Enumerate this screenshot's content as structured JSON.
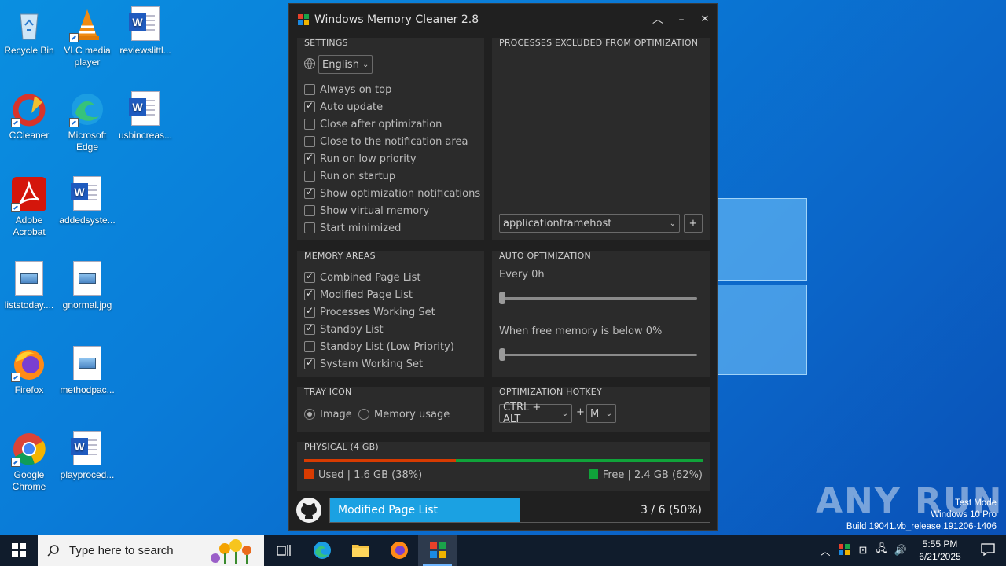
{
  "desktop": {
    "icons": [
      {
        "label": "Recycle Bin"
      },
      {
        "label": "VLC media player"
      },
      {
        "label": "reviewslittl..."
      },
      {
        "label": "CCleaner"
      },
      {
        "label": "Microsoft Edge"
      },
      {
        "label": "usbincreas..."
      },
      {
        "label": "Adobe Acrobat"
      },
      {
        "label": "addedsyste..."
      },
      {
        "label": "liststoday...."
      },
      {
        "label": "gnormal.jpg"
      },
      {
        "label": "Firefox"
      },
      {
        "label": "methodpac..."
      },
      {
        "label": "Google Chrome"
      },
      {
        "label": "playproced..."
      }
    ],
    "watermark": {
      "brand": "ANY RUN",
      "line1": "Test Mode",
      "line2": "Windows 10 Pro",
      "line3": "Build 19041.vb_release.191206-1406"
    }
  },
  "app": {
    "title": "Windows Memory Cleaner 2.8",
    "settings": {
      "title": "SETTINGS",
      "language": "English",
      "options": [
        {
          "label": "Always on top",
          "checked": false
        },
        {
          "label": "Auto update",
          "checked": true
        },
        {
          "label": "Close after optimization",
          "checked": false
        },
        {
          "label": "Close to the notification area",
          "checked": false
        },
        {
          "label": "Run on low priority",
          "checked": true
        },
        {
          "label": "Run on startup",
          "checked": false
        },
        {
          "label": "Show optimization notifications",
          "checked": true
        },
        {
          "label": "Show virtual memory",
          "checked": false
        },
        {
          "label": "Start minimized",
          "checked": false
        }
      ]
    },
    "excluded": {
      "title": "PROCESSES EXCLUDED FROM OPTIMIZATION",
      "selected_process": "applicationframehost",
      "add_label": "+"
    },
    "memory_areas": {
      "title": "MEMORY AREAS",
      "items": [
        {
          "label": "Combined Page List",
          "checked": true
        },
        {
          "label": "Modified Page List",
          "checked": true
        },
        {
          "label": "Processes Working Set",
          "checked": true
        },
        {
          "label": "Standby List",
          "checked": true
        },
        {
          "label": "Standby List (Low Priority)",
          "checked": false
        },
        {
          "label": "System Working Set",
          "checked": true
        }
      ]
    },
    "auto_optimization": {
      "title": "AUTO OPTIMIZATION",
      "every_label": "Every 0h",
      "every_value": 0,
      "free_label": "When free memory is below 0%",
      "free_value": 0
    },
    "tray_icon": {
      "title": "TRAY ICON",
      "options": [
        {
          "label": "Image",
          "selected": true
        },
        {
          "label": "Memory usage",
          "selected": false
        }
      ]
    },
    "hotkey": {
      "title": "OPTIMIZATION HOTKEY",
      "modifier": "CTRL + ALT",
      "plus": "+",
      "key": "M"
    },
    "physical": {
      "title": "PHYSICAL (4 GB)",
      "used_label": "Used | 1.6 GB (38%)",
      "free_label": "Free | 2.4 GB (62%)",
      "used_fraction": 0.38,
      "used_color": "#d83b01",
      "free_color": "#10a33a"
    },
    "status": {
      "text": "Modified Page List",
      "progress_text": "3 / 6 (50%)",
      "progress_fraction": 0.5,
      "progress_color": "#1ba1e2"
    }
  },
  "taskbar": {
    "search_placeholder": "Type here to search",
    "time": "5:55 PM",
    "date": "6/21/2025"
  }
}
